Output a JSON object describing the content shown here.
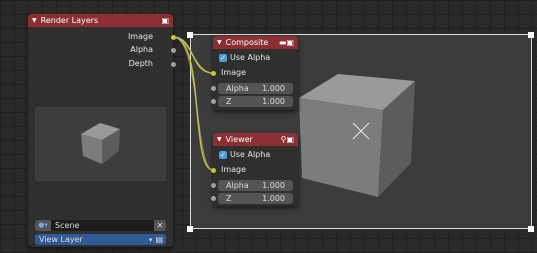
{
  "render_layers": {
    "title": "Render Layers",
    "outputs": [
      "Image",
      "Alpha",
      "Depth"
    ],
    "scene_label": "Scene",
    "layer_label": "View Layer"
  },
  "composite": {
    "title": "Composite",
    "use_alpha_label": "Use Alpha",
    "image_label": "Image",
    "alpha_label": "Alpha",
    "alpha_value": "1.000",
    "z_label": "Z",
    "z_value": "1.000"
  },
  "viewer": {
    "title": "Viewer",
    "use_alpha_label": "Use Alpha",
    "image_label": "Image",
    "alpha_label": "Alpha",
    "alpha_value": "1.000",
    "z_label": "Z",
    "z_value": "1.000"
  },
  "colors": {
    "header": "#8b2f33",
    "socket_image": "#c7c729",
    "socket_value": "#a1a1a1",
    "checkbox": "#4a9ddb",
    "selection": "#2f5a95"
  }
}
